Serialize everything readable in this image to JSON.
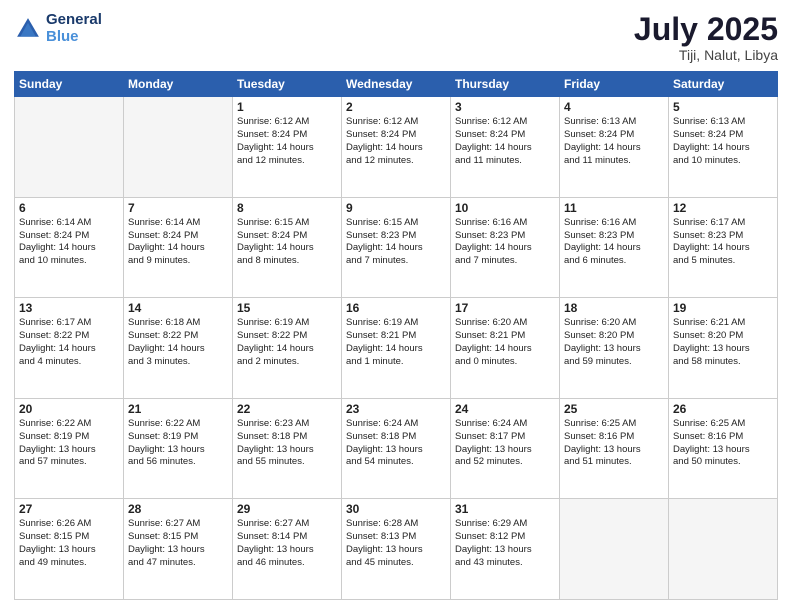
{
  "header": {
    "logo_line1": "General",
    "logo_line2": "Blue",
    "month": "July 2025",
    "location": "Tiji, Nalut, Libya"
  },
  "days_of_week": [
    "Sunday",
    "Monday",
    "Tuesday",
    "Wednesday",
    "Thursday",
    "Friday",
    "Saturday"
  ],
  "weeks": [
    [
      {
        "day": "",
        "empty": true
      },
      {
        "day": "",
        "empty": true
      },
      {
        "day": "1",
        "lines": [
          "Sunrise: 6:12 AM",
          "Sunset: 8:24 PM",
          "Daylight: 14 hours",
          "and 12 minutes."
        ]
      },
      {
        "day": "2",
        "lines": [
          "Sunrise: 6:12 AM",
          "Sunset: 8:24 PM",
          "Daylight: 14 hours",
          "and 12 minutes."
        ]
      },
      {
        "day": "3",
        "lines": [
          "Sunrise: 6:12 AM",
          "Sunset: 8:24 PM",
          "Daylight: 14 hours",
          "and 11 minutes."
        ]
      },
      {
        "day": "4",
        "lines": [
          "Sunrise: 6:13 AM",
          "Sunset: 8:24 PM",
          "Daylight: 14 hours",
          "and 11 minutes."
        ]
      },
      {
        "day": "5",
        "lines": [
          "Sunrise: 6:13 AM",
          "Sunset: 8:24 PM",
          "Daylight: 14 hours",
          "and 10 minutes."
        ]
      }
    ],
    [
      {
        "day": "6",
        "lines": [
          "Sunrise: 6:14 AM",
          "Sunset: 8:24 PM",
          "Daylight: 14 hours",
          "and 10 minutes."
        ]
      },
      {
        "day": "7",
        "lines": [
          "Sunrise: 6:14 AM",
          "Sunset: 8:24 PM",
          "Daylight: 14 hours",
          "and 9 minutes."
        ]
      },
      {
        "day": "8",
        "lines": [
          "Sunrise: 6:15 AM",
          "Sunset: 8:24 PM",
          "Daylight: 14 hours",
          "and 8 minutes."
        ]
      },
      {
        "day": "9",
        "lines": [
          "Sunrise: 6:15 AM",
          "Sunset: 8:23 PM",
          "Daylight: 14 hours",
          "and 7 minutes."
        ]
      },
      {
        "day": "10",
        "lines": [
          "Sunrise: 6:16 AM",
          "Sunset: 8:23 PM",
          "Daylight: 14 hours",
          "and 7 minutes."
        ]
      },
      {
        "day": "11",
        "lines": [
          "Sunrise: 6:16 AM",
          "Sunset: 8:23 PM",
          "Daylight: 14 hours",
          "and 6 minutes."
        ]
      },
      {
        "day": "12",
        "lines": [
          "Sunrise: 6:17 AM",
          "Sunset: 8:23 PM",
          "Daylight: 14 hours",
          "and 5 minutes."
        ]
      }
    ],
    [
      {
        "day": "13",
        "lines": [
          "Sunrise: 6:17 AM",
          "Sunset: 8:22 PM",
          "Daylight: 14 hours",
          "and 4 minutes."
        ]
      },
      {
        "day": "14",
        "lines": [
          "Sunrise: 6:18 AM",
          "Sunset: 8:22 PM",
          "Daylight: 14 hours",
          "and 3 minutes."
        ]
      },
      {
        "day": "15",
        "lines": [
          "Sunrise: 6:19 AM",
          "Sunset: 8:22 PM",
          "Daylight: 14 hours",
          "and 2 minutes."
        ]
      },
      {
        "day": "16",
        "lines": [
          "Sunrise: 6:19 AM",
          "Sunset: 8:21 PM",
          "Daylight: 14 hours",
          "and 1 minute."
        ]
      },
      {
        "day": "17",
        "lines": [
          "Sunrise: 6:20 AM",
          "Sunset: 8:21 PM",
          "Daylight: 14 hours",
          "and 0 minutes."
        ]
      },
      {
        "day": "18",
        "lines": [
          "Sunrise: 6:20 AM",
          "Sunset: 8:20 PM",
          "Daylight: 13 hours",
          "and 59 minutes."
        ]
      },
      {
        "day": "19",
        "lines": [
          "Sunrise: 6:21 AM",
          "Sunset: 8:20 PM",
          "Daylight: 13 hours",
          "and 58 minutes."
        ]
      }
    ],
    [
      {
        "day": "20",
        "lines": [
          "Sunrise: 6:22 AM",
          "Sunset: 8:19 PM",
          "Daylight: 13 hours",
          "and 57 minutes."
        ]
      },
      {
        "day": "21",
        "lines": [
          "Sunrise: 6:22 AM",
          "Sunset: 8:19 PM",
          "Daylight: 13 hours",
          "and 56 minutes."
        ]
      },
      {
        "day": "22",
        "lines": [
          "Sunrise: 6:23 AM",
          "Sunset: 8:18 PM",
          "Daylight: 13 hours",
          "and 55 minutes."
        ]
      },
      {
        "day": "23",
        "lines": [
          "Sunrise: 6:24 AM",
          "Sunset: 8:18 PM",
          "Daylight: 13 hours",
          "and 54 minutes."
        ]
      },
      {
        "day": "24",
        "lines": [
          "Sunrise: 6:24 AM",
          "Sunset: 8:17 PM",
          "Daylight: 13 hours",
          "and 52 minutes."
        ]
      },
      {
        "day": "25",
        "lines": [
          "Sunrise: 6:25 AM",
          "Sunset: 8:16 PM",
          "Daylight: 13 hours",
          "and 51 minutes."
        ]
      },
      {
        "day": "26",
        "lines": [
          "Sunrise: 6:25 AM",
          "Sunset: 8:16 PM",
          "Daylight: 13 hours",
          "and 50 minutes."
        ]
      }
    ],
    [
      {
        "day": "27",
        "lines": [
          "Sunrise: 6:26 AM",
          "Sunset: 8:15 PM",
          "Daylight: 13 hours",
          "and 49 minutes."
        ]
      },
      {
        "day": "28",
        "lines": [
          "Sunrise: 6:27 AM",
          "Sunset: 8:15 PM",
          "Daylight: 13 hours",
          "and 47 minutes."
        ]
      },
      {
        "day": "29",
        "lines": [
          "Sunrise: 6:27 AM",
          "Sunset: 8:14 PM",
          "Daylight: 13 hours",
          "and 46 minutes."
        ]
      },
      {
        "day": "30",
        "lines": [
          "Sunrise: 6:28 AM",
          "Sunset: 8:13 PM",
          "Daylight: 13 hours",
          "and 45 minutes."
        ]
      },
      {
        "day": "31",
        "lines": [
          "Sunrise: 6:29 AM",
          "Sunset: 8:12 PM",
          "Daylight: 13 hours",
          "and 43 minutes."
        ]
      },
      {
        "day": "",
        "empty": true
      },
      {
        "day": "",
        "empty": true
      }
    ]
  ]
}
